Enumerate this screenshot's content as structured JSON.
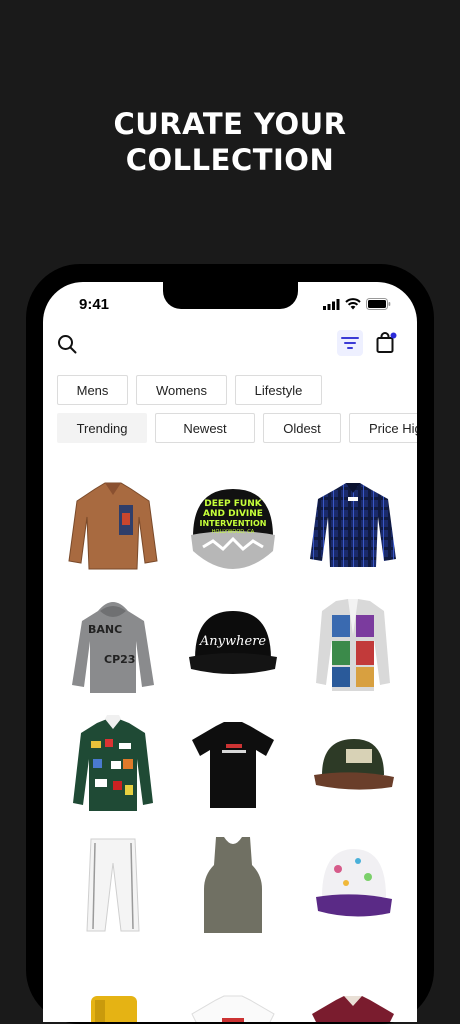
{
  "headline": {
    "line1": "CURATE YOUR",
    "line2": "COLLECTION"
  },
  "status_bar": {
    "time": "9:41"
  },
  "filters": {
    "categories": [
      "Mens",
      "Womens",
      "Lifestyle"
    ],
    "sort_options": [
      "Trending",
      "Newest",
      "Oldest",
      "Price High"
    ],
    "active_sort": "Trending"
  },
  "colors": {
    "accent": "#3b3bd6",
    "background": "#1a1a1a",
    "cart_badge": "#2b2bd9"
  },
  "products": [
    {
      "name": "brown-work-jacket"
    },
    {
      "name": "black-deep-funk-cap"
    },
    {
      "name": "blue-plaid-jacket"
    },
    {
      "name": "grey-hoodie"
    },
    {
      "name": "black-anywhere-cap"
    },
    {
      "name": "patterned-cardigan"
    },
    {
      "name": "green-patch-rugby-shirt"
    },
    {
      "name": "black-tee"
    },
    {
      "name": "green-brown-cap"
    },
    {
      "name": "white-jeans"
    },
    {
      "name": "grey-tank-top"
    },
    {
      "name": "purple-print-cap"
    },
    {
      "name": "yellow-boots"
    },
    {
      "name": "white-tee"
    },
    {
      "name": "maroon-jersey"
    }
  ],
  "product_texts": {
    "cap1_l1": "DEEP FUNK",
    "cap1_l2": "AND DIVINE",
    "cap1_l3": "INTERVENTION",
    "cap1_l4": "HOLLYWOOD, CA",
    "hoodie_l1": "BANC",
    "hoodie_l2": "CP23",
    "cap2": "Anywhere"
  }
}
